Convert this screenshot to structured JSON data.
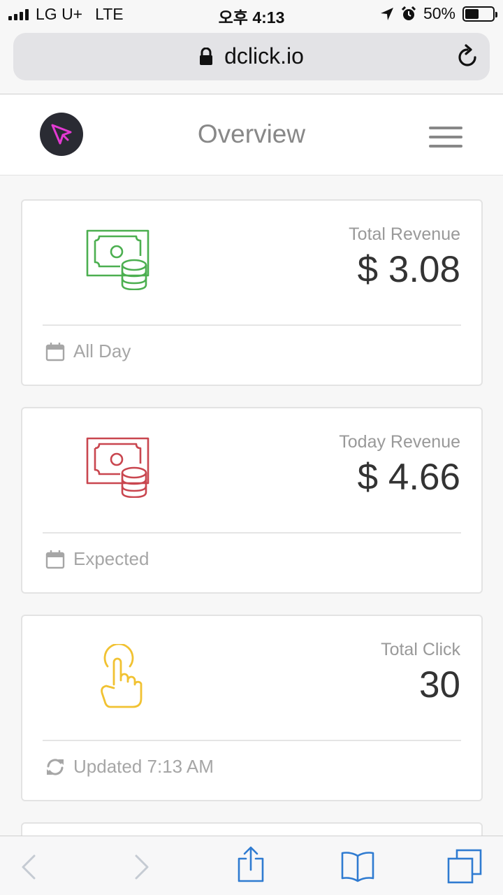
{
  "status_bar": {
    "carrier": "LG U+",
    "network": "LTE",
    "time": "오후 4:13",
    "battery_percent": "50%",
    "battery_level": 0.5
  },
  "browser": {
    "url": "dclick.io",
    "icons": {
      "lock": "lock-icon",
      "reload": "reload-icon",
      "back": "back-arrow-icon",
      "forward": "forward-arrow-icon",
      "share": "share-icon",
      "bookmarks": "bookmarks-icon",
      "tabs": "tabs-icon"
    }
  },
  "header": {
    "title": "Overview",
    "logo_icon": "dclick-logo",
    "menu_icon": "hamburger-menu-icon"
  },
  "cards": [
    {
      "label": "Total Revenue",
      "value": "$ 3.08",
      "footer": "All Day",
      "icon": "money-coins-icon",
      "footer_icon": "calendar-icon",
      "color": "#4caf50"
    },
    {
      "label": "Today Revenue",
      "value": "$ 4.66",
      "footer": "Expected",
      "icon": "money-coins-icon",
      "footer_icon": "calendar-icon",
      "color": "#c9464f"
    },
    {
      "label": "Total Click",
      "value": "30",
      "footer": "Updated 7:13 AM",
      "icon": "hand-pointer-icon",
      "footer_icon": "refresh-icon",
      "color": "#f1c232"
    }
  ],
  "colors": {
    "accent_blue": "#2f7bd1",
    "logo_pink": "#e33ad2",
    "logo_bg": "#2a2b33"
  }
}
